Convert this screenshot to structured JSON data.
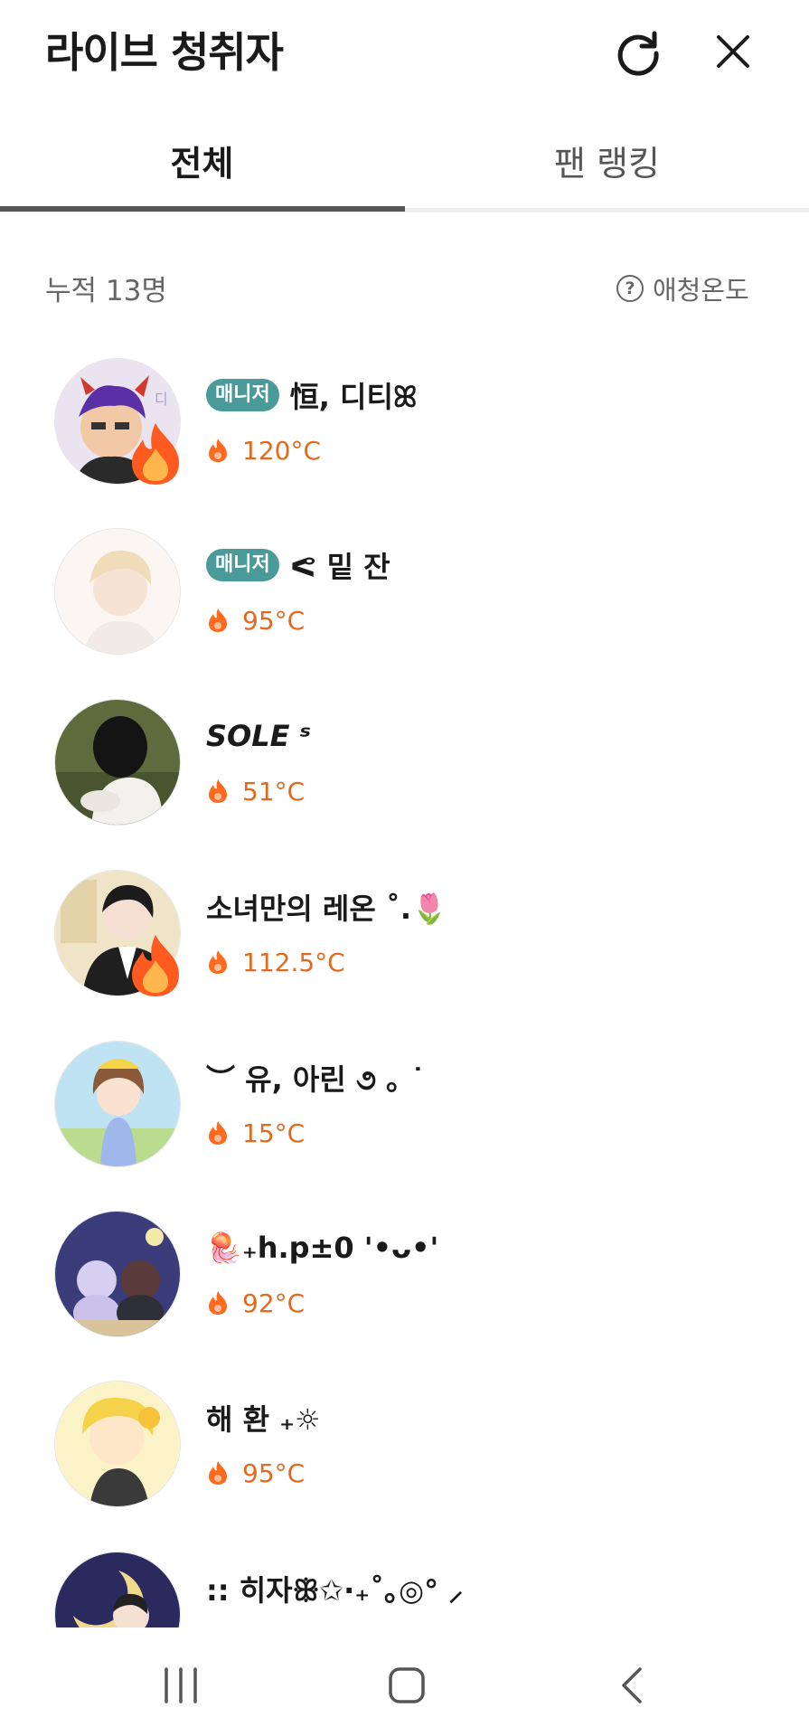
{
  "header": {
    "title": "라이브 청취자"
  },
  "tabs": [
    {
      "label": "전체",
      "active": true
    },
    {
      "label": "팬 랭킹",
      "active": false
    }
  ],
  "summary": {
    "count_text": "누적 13명",
    "help_label": "애청온도"
  },
  "listeners": [
    {
      "name": "恒, 디티ꕤ",
      "badge": "매니저",
      "temperature": "120°C",
      "hot": true
    },
    {
      "name": "ᕙ 밑 잔",
      "badge": "매니저",
      "temperature": "95°C",
      "hot": false
    },
    {
      "name": "SOLE ˢ",
      "badge": "",
      "temperature": "51°C",
      "hot": false
    },
    {
      "name": "소녀만의 레온 ˚.🌷",
      "badge": "",
      "temperature": "112.5°C",
      "hot": true
    },
    {
      "name": "︶ 유, 아린 ૭ ｡ ˙",
      "badge": "",
      "temperature": "15°C",
      "hot": false
    },
    {
      "name": "🪼₊h.p±0 '•ᴗ•'",
      "badge": "",
      "temperature": "92°C",
      "hot": false
    },
    {
      "name": "해 환  ₊☼",
      "badge": "",
      "temperature": "95°C",
      "hot": false
    },
    {
      "name": ":: 히자ꕥ✩·₊˚｡◎°  ⸝",
      "badge": "",
      "temperature": "",
      "hot": false
    }
  ],
  "icons": {
    "refresh": "refresh-icon",
    "close": "close-icon",
    "help": "question-circle-icon",
    "flame": "flame-icon"
  },
  "colors": {
    "manager_badge": "#4a9a99",
    "temperature": "#e26a1f",
    "active_tab_underline": "#555555"
  }
}
